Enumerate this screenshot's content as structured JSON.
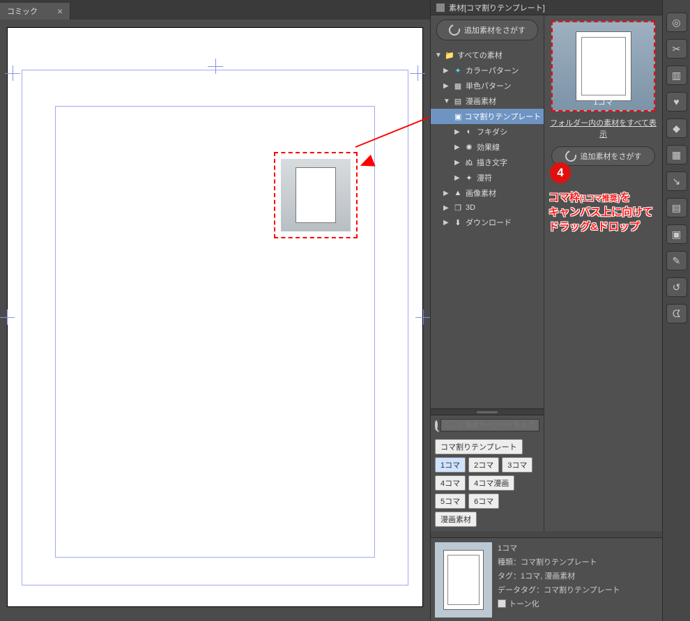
{
  "tab": {
    "label": "コミック"
  },
  "panel": {
    "title": "素材[コマ割りテンプレート]"
  },
  "find_more": "追加素材をさがす",
  "tree": {
    "root": "すべての素材",
    "color_pattern": "カラーパターン",
    "mono_pattern": "単色パターン",
    "manga": "漫画素材",
    "frame_template": "コマ割りテンプレート",
    "balloon": "フキダシ",
    "effect": "効果線",
    "drawn_text": "描き文字",
    "manpu": "漫符",
    "image": "画像素材",
    "threed": "3D",
    "download": "ダウンロード"
  },
  "search": {
    "placeholder": "ここに検索キーワードを入力してくだ"
  },
  "tags": {
    "t0": "コマ割りテンプレート",
    "t1": "1コマ",
    "t2": "2コマ",
    "t3": "3コマ",
    "t4": "4コマ",
    "t5": "4コマ漫画",
    "t6": "5コマ",
    "t7": "6コマ",
    "t8": "漫画素材"
  },
  "thumb": {
    "label": "1コマ",
    "show_all": "フォルダー内の素材をすべて表示"
  },
  "annotation": {
    "step_number": "4",
    "line1": "コマ枠",
    "line1_small": "(1コマ推奨)",
    "line1_tail": "を",
    "line2": "キャンバス上に向けて",
    "line3": "ドラッグ&ドロップ"
  },
  "info": {
    "name": "1コマ",
    "kind": "種類：コマ割りテンプレート",
    "tag": "タグ：1コマ, 漫画素材",
    "datatag": "データタグ：コマ割りテンプレート",
    "tone": "トーン化"
  }
}
